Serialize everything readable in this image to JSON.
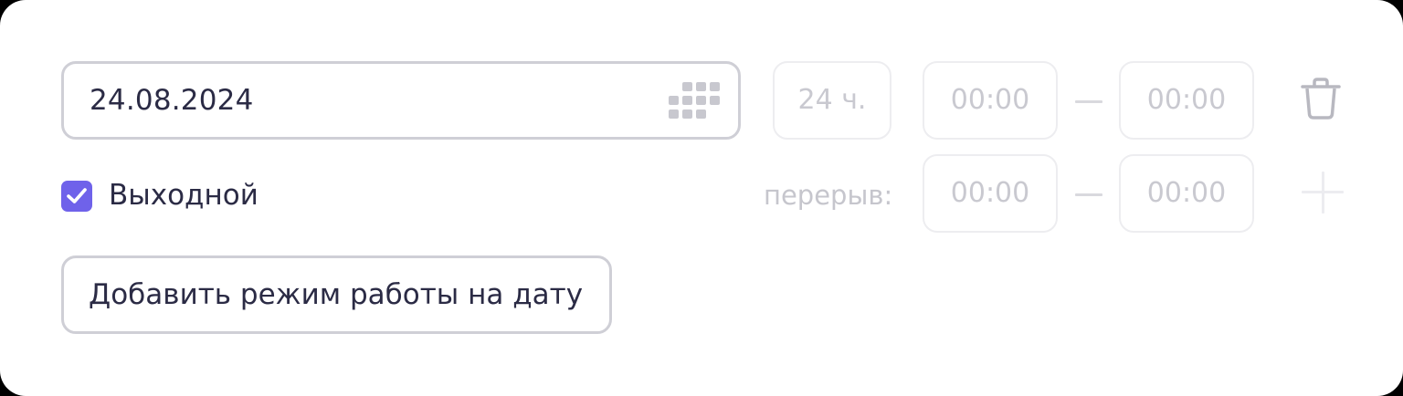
{
  "date_row": {
    "date_value": "24.08.2024",
    "calendar_icon": "calendar-grid-icon",
    "hours_value": "24 ч.",
    "open_time": "00:00",
    "close_time": "00:00",
    "delete_icon": "trash-icon"
  },
  "break_row": {
    "day_off_label": "Выходной",
    "day_off_checked": true,
    "break_label": "перерыв:",
    "break_start": "00:00",
    "break_end": "00:00",
    "add_icon": "plus-icon"
  },
  "add_button_label": "Добавить режим работы на дату",
  "colors": {
    "accent": "#6f62ea",
    "text": "#2b2b45",
    "disabled_text": "#c9c9d0",
    "border": "#cfcfd6"
  }
}
